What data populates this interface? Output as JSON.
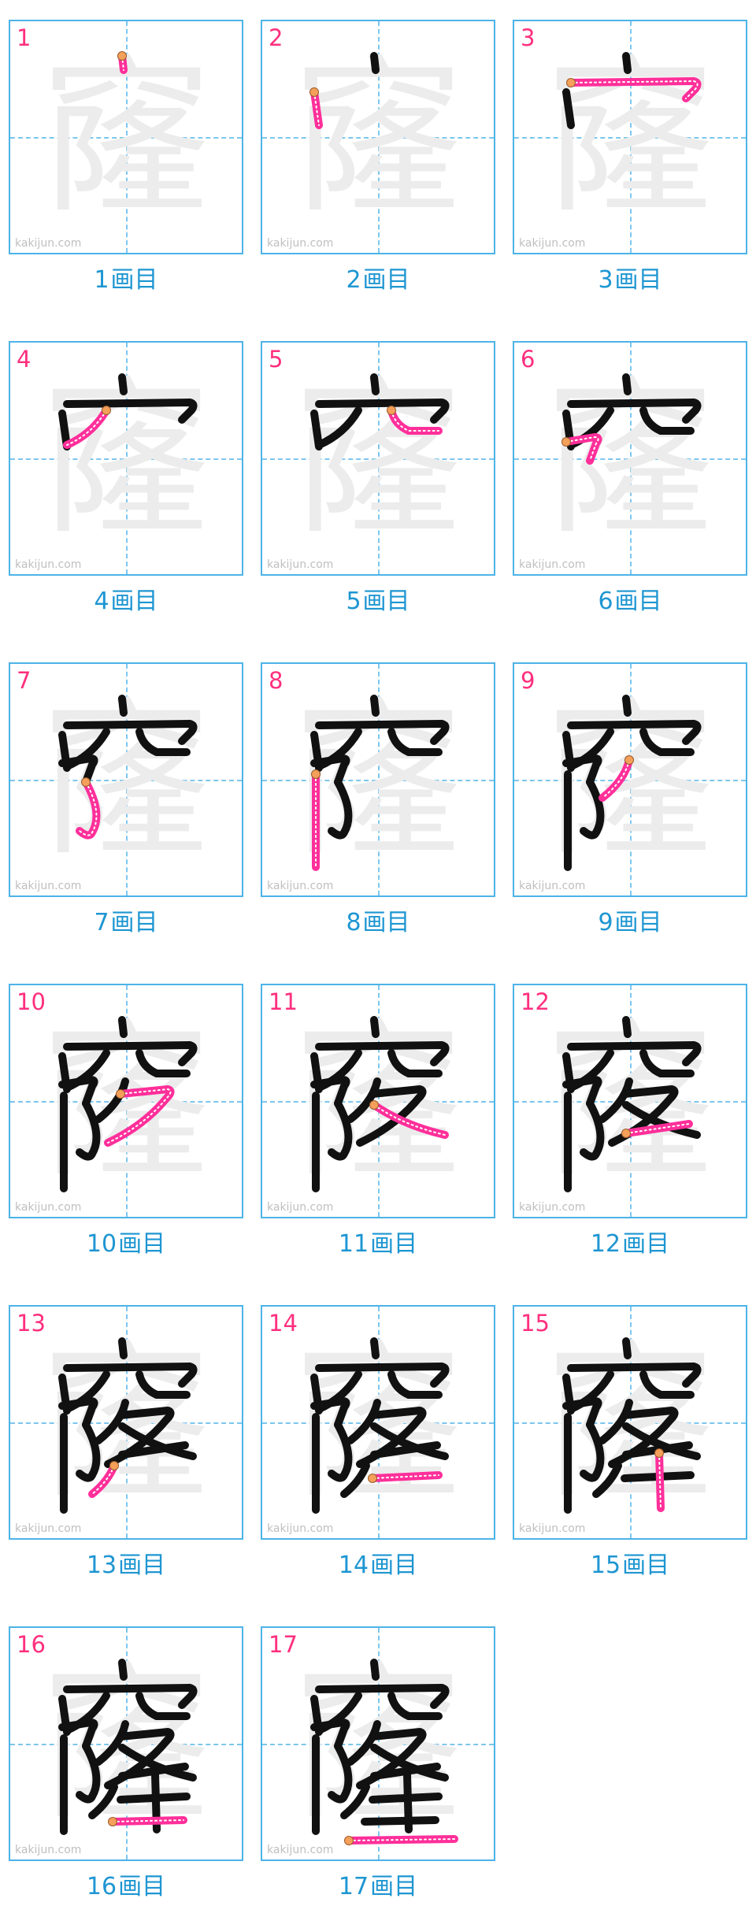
{
  "character": "窿",
  "watermark": "kakijun.com",
  "count_suffix": "画目",
  "colors": {
    "done_stroke": "#111111",
    "current_stroke": "#ff2f9a",
    "start_dot": "#f4a05a",
    "grid_border": "#4db3e8",
    "guide_line": "#7cc6ee",
    "ghost": "#ececec",
    "step_number": "#ff2f7e",
    "caption": "#1e96d2"
  },
  "steps": [
    {
      "number": "1",
      "caption": "1"
    },
    {
      "number": "2",
      "caption": "2"
    },
    {
      "number": "3",
      "caption": "3"
    },
    {
      "number": "4",
      "caption": "4"
    },
    {
      "number": "5",
      "caption": "5"
    },
    {
      "number": "6",
      "caption": "6"
    },
    {
      "number": "7",
      "caption": "7"
    },
    {
      "number": "8",
      "caption": "8"
    },
    {
      "number": "9",
      "caption": "9"
    },
    {
      "number": "10",
      "caption": "10"
    },
    {
      "number": "11",
      "caption": "11"
    },
    {
      "number": "12",
      "caption": "12"
    },
    {
      "number": "13",
      "caption": "13"
    },
    {
      "number": "14",
      "caption": "14"
    },
    {
      "number": "15",
      "caption": "15"
    },
    {
      "number": "16",
      "caption": "16"
    },
    {
      "number": "17",
      "caption": "17"
    }
  ]
}
